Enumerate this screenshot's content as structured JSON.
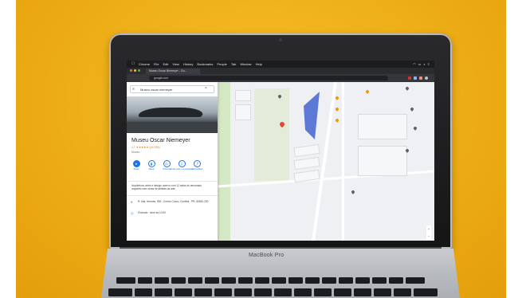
{
  "browser": {
    "menubar": {
      "apple": "",
      "items": [
        "Chrome",
        "File",
        "Edit",
        "View",
        "History",
        "Bookmarks",
        "People",
        "Tab",
        "Window",
        "Help"
      ]
    },
    "tab_title": "Museu Oscar Niemeyer - Go...",
    "url": "google.com"
  },
  "maps_panel": {
    "search_value": "Museu oscar niemeyer",
    "place_title": "Museu Oscar Niemeyer",
    "rating": "4,7 ★★★★★ (44.325)",
    "category": "Museu",
    "actions": [
      "Rotas",
      "Salvar",
      "Próximo",
      "Enviar para o smartphone",
      "Compartilhar"
    ],
    "description": "Arquitetura, artes e design: acervo com 12 salas do renomado arquiteto com obras de artistas da arte.",
    "address": "R. Mal. Hermes, 999 - Centro Cívico, Curitiba - PR, 80530-230",
    "hours": "Fechado · Abre às 10:00"
  },
  "laptop": {
    "brand": "MacBook Pro"
  },
  "colors": {
    "background": "#ecab14",
    "map_blue": "#5c79d6",
    "pin_red": "#ea4335",
    "accent_blue": "#1a73e8"
  }
}
